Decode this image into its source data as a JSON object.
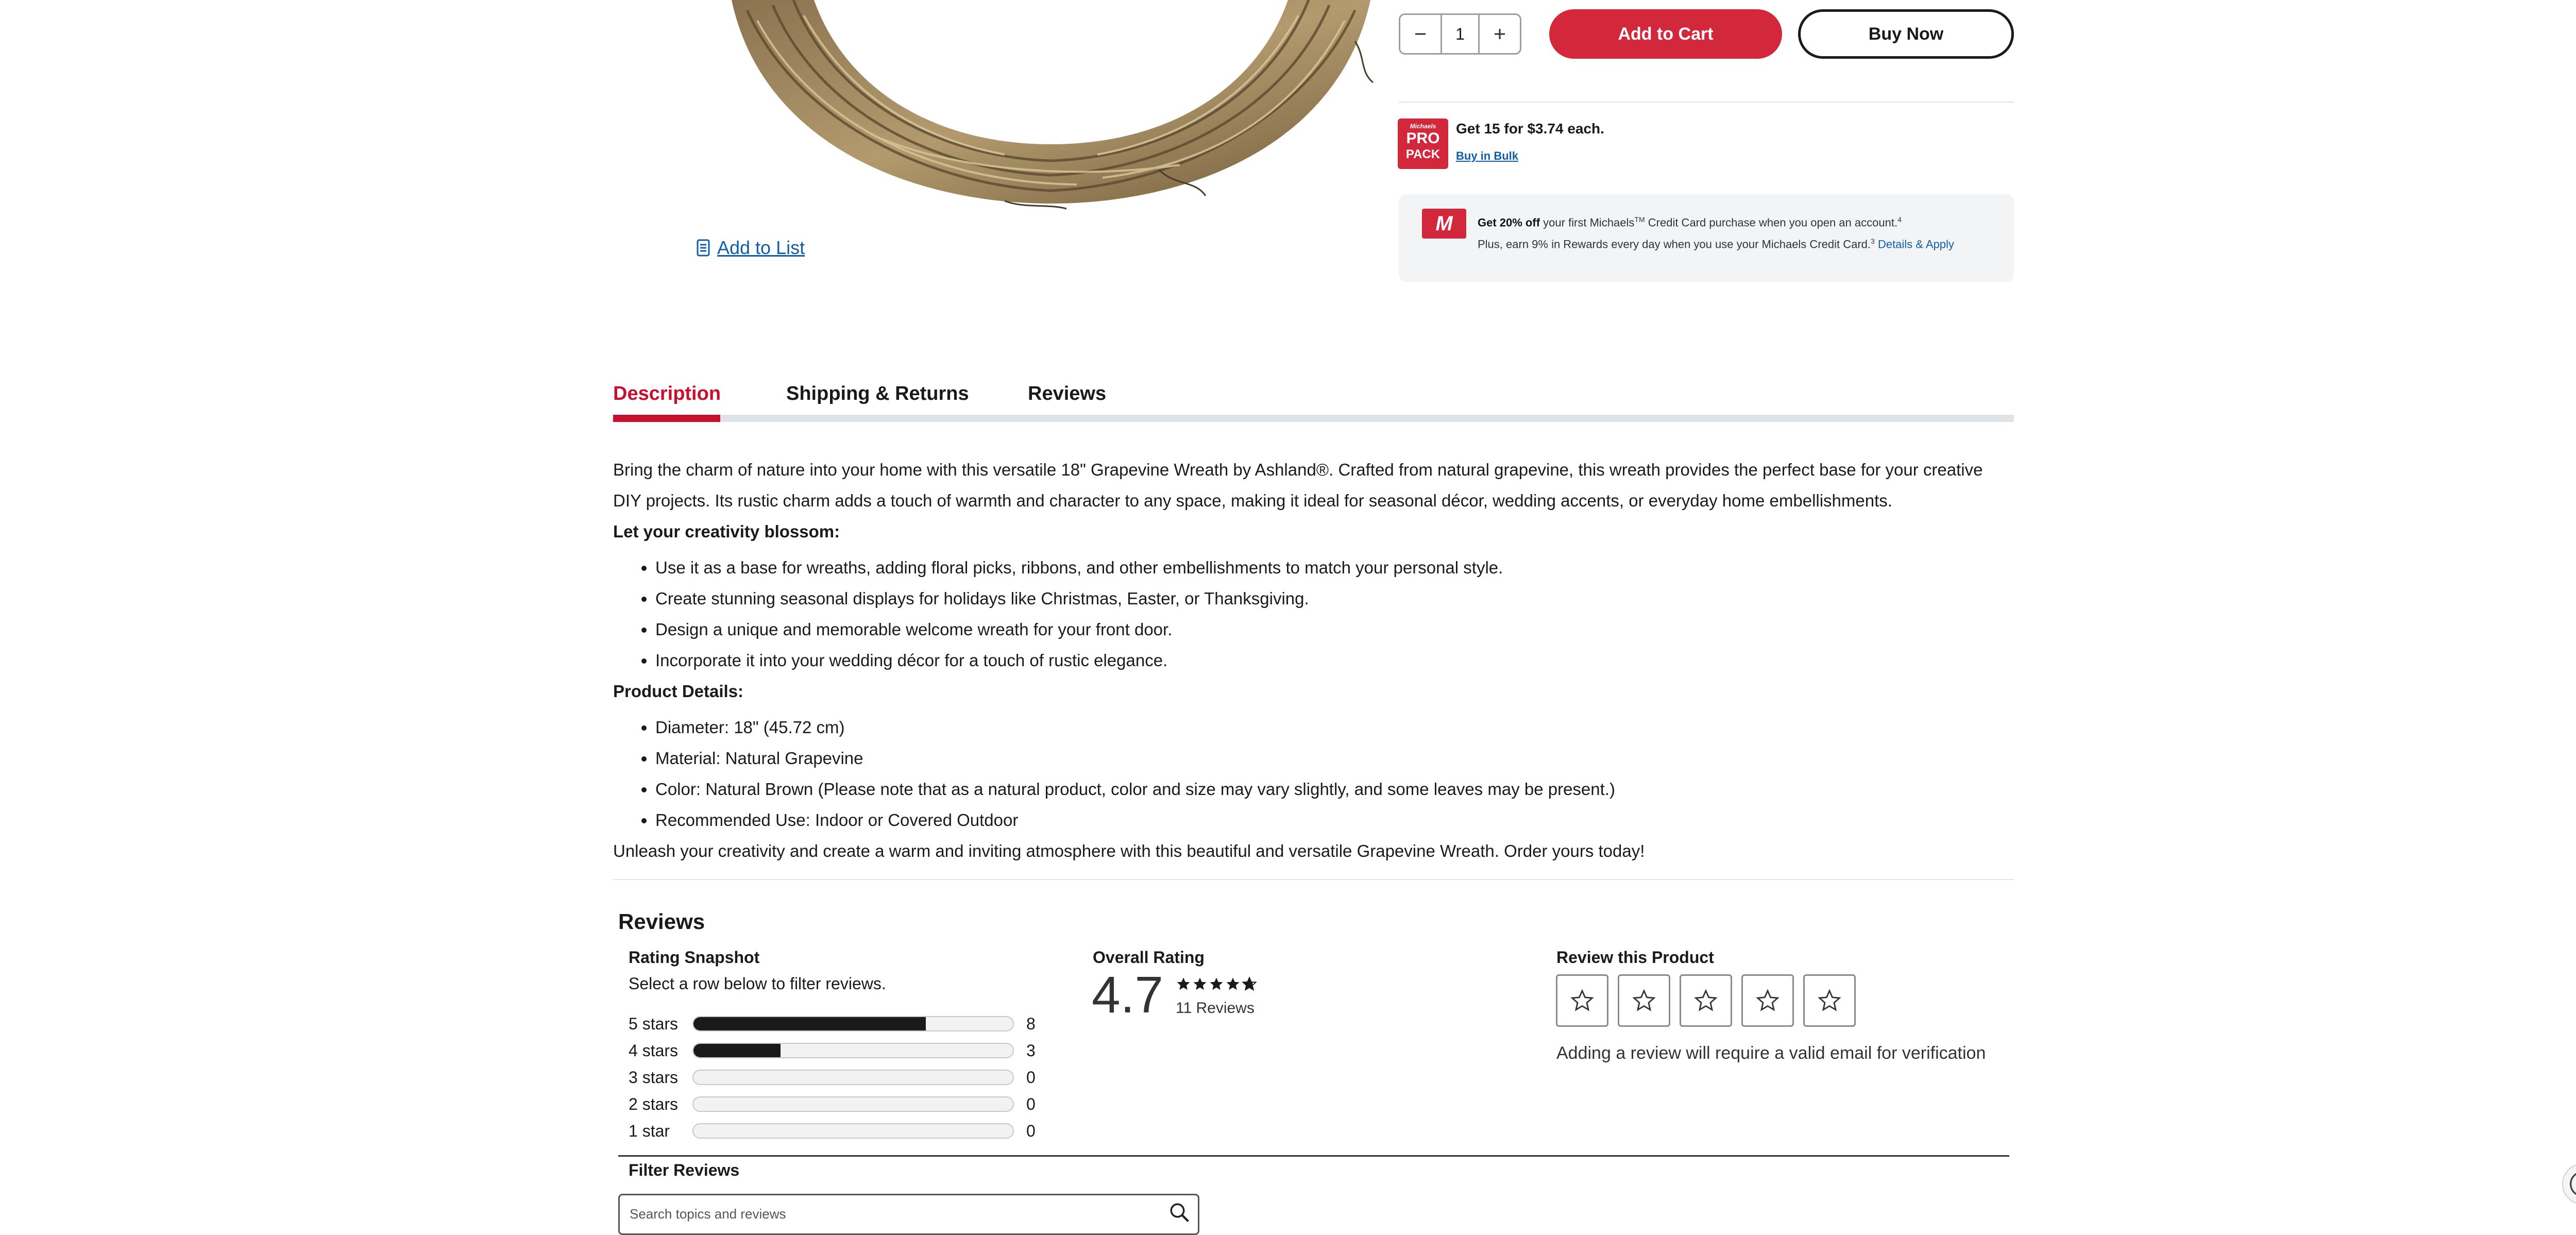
{
  "product": {
    "add_to_list_label": "Add to List",
    "quantity": "1",
    "add_to_cart_label": "Add to Cart",
    "buy_now_label": "Buy Now"
  },
  "bulk": {
    "logo_small": "Michaels",
    "logo_line1": "PRO",
    "logo_line2": "PACK",
    "headline": "Get 15 for $3.74 each.",
    "link_label": "Buy in Bulk"
  },
  "credit": {
    "logo": "M",
    "offer_bold": "Get 20% off",
    "offer_text": " your first Michaels",
    "offer_tm": "TM",
    "offer_text2": " Credit Card purchase when you open an account.",
    "offer_sup": "4",
    "rewards_text": "Plus, earn 9% in Rewards every day when you use your Michaels Credit Card.",
    "rewards_sup": "3",
    "details_link": " Details & Apply"
  },
  "tabs": [
    {
      "label": "Description"
    },
    {
      "label": "Shipping & Returns"
    },
    {
      "label": "Reviews"
    }
  ],
  "description": {
    "intro": "Bring the charm of nature into your home with this versatile 18\" Grapevine Wreath by Ashland®. Crafted from natural grapevine, this wreath provides the perfect base for your creative DIY projects. Its rustic charm adds a touch of warmth and character to any space, making it ideal for seasonal décor, wedding accents, or everyday home embellishments.",
    "creativity_heading": "Let your creativity blossom:",
    "creativity_items": [
      "Use it as a base for wreaths, adding floral picks, ribbons, and other embellishments to match your personal style.",
      "Create stunning seasonal displays for holidays like Christmas, Easter, or Thanksgiving.",
      "Design a unique and memorable welcome wreath for your front door.",
      "Incorporate it into your wedding décor for a touch of rustic elegance."
    ],
    "details_heading": "Product Details:",
    "details_items": [
      "Diameter: 18\" (45.72 cm)",
      "Material: Natural Grapevine",
      "Color: Natural Brown (Please note that as a natural product, color and size may vary slightly, and some leaves may be present.)",
      "Recommended Use: Indoor or Covered Outdoor"
    ],
    "closing": "Unleash your creativity and create a warm and inviting atmosphere with this beautiful and versatile Grapevine Wreath. Order yours today!"
  },
  "reviews": {
    "heading": "Reviews",
    "snapshot_title": "Rating Snapshot",
    "snapshot_sub": "Select a row below to filter reviews.",
    "rows": [
      {
        "label": "5 stars",
        "count": "8",
        "fraction": 0.727
      },
      {
        "label": "4 stars",
        "count": "3",
        "fraction": 0.273
      },
      {
        "label": "3 stars",
        "count": "0",
        "fraction": 0
      },
      {
        "label": "2 stars",
        "count": "0",
        "fraction": 0
      },
      {
        "label": "1 star",
        "count": "0",
        "fraction": 0
      }
    ],
    "overall_title": "Overall Rating",
    "overall_value": "4.7",
    "overall_count": "11 Reviews",
    "review_title": "Review this Product",
    "review_note": "Adding a review will require a valid email for verification",
    "filter_title": "Filter Reviews",
    "search_placeholder": "Search topics and reviews"
  }
}
